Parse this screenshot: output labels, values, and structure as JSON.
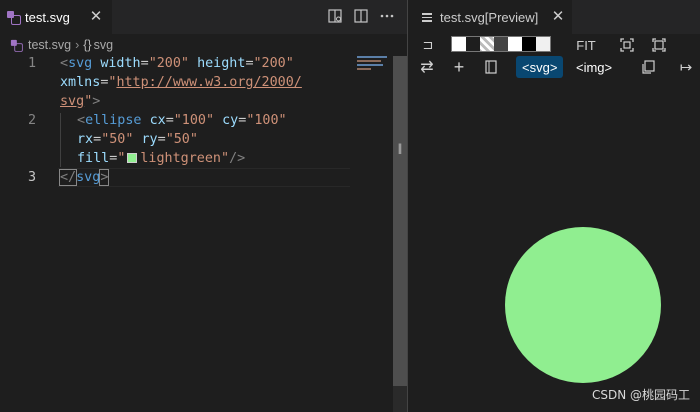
{
  "left_tab": {
    "label": "test.svg",
    "close_glyph": "✕",
    "icon": "svg-file-icon"
  },
  "editor_actions": [
    "open-preview-icon",
    "split-editor-icon",
    "more-actions-icon"
  ],
  "breadcrumb": {
    "file": "test.svg",
    "symbol_glyph": "{}",
    "symbol": "svg"
  },
  "code": {
    "line_numbers": [
      "1",
      "2",
      "3"
    ],
    "l1a": {
      "p1": "<",
      "tag": "svg",
      "a1": "width",
      "eq1": "=",
      "v1": "\"200\"",
      "a2": "height",
      "eq2": "=",
      "v2": "\"200\""
    },
    "l1b": {
      "a3": "xmlns",
      "eq3": "=",
      "q1": "\"",
      "url1": "http://www.w3.org/2000/"
    },
    "l1c": {
      "url2": "svg",
      "q2": "\"",
      "p2": ">"
    },
    "l2a": {
      "p1": "<",
      "tag": "ellipse",
      "a1": "cx",
      "eq1": "=",
      "v1": "\"100\"",
      "a2": "cy",
      "eq2": "=",
      "v2": "\"100\""
    },
    "l2b": {
      "a3": "rx",
      "eq3": "=",
      "v3": "\"50\"",
      "a4": "ry",
      "eq4": "=",
      "v4": "\"50\""
    },
    "l2c": {
      "a5": "fill",
      "eq5": "=",
      "q1": "\"",
      "v5": "lightgreen",
      "q2": "\"",
      "p2": "/>"
    },
    "l3": {
      "p1": "</",
      "tag": "svg",
      "p2": ">"
    }
  },
  "fill_color": "#90ee90",
  "scroll_cursor_glyph": "I",
  "preview_tab": {
    "label": "test.svg[Preview]",
    "close_glyph": "✕"
  },
  "preview_toolbar": {
    "pin_glyph": "⊐",
    "fit_label": "FIT",
    "swap_glyph": "⇄",
    "add_glyph": "+",
    "svg_label": "<svg>",
    "img_label": "<img>",
    "arrow_glyph": "↦",
    "bg_swatches": [
      "#ffffff",
      "#1e1e1e",
      "checker",
      "#444444",
      "#ffffff",
      "#000000",
      "#f0f0f0"
    ]
  },
  "watermark": "CSDN @桃园码工"
}
